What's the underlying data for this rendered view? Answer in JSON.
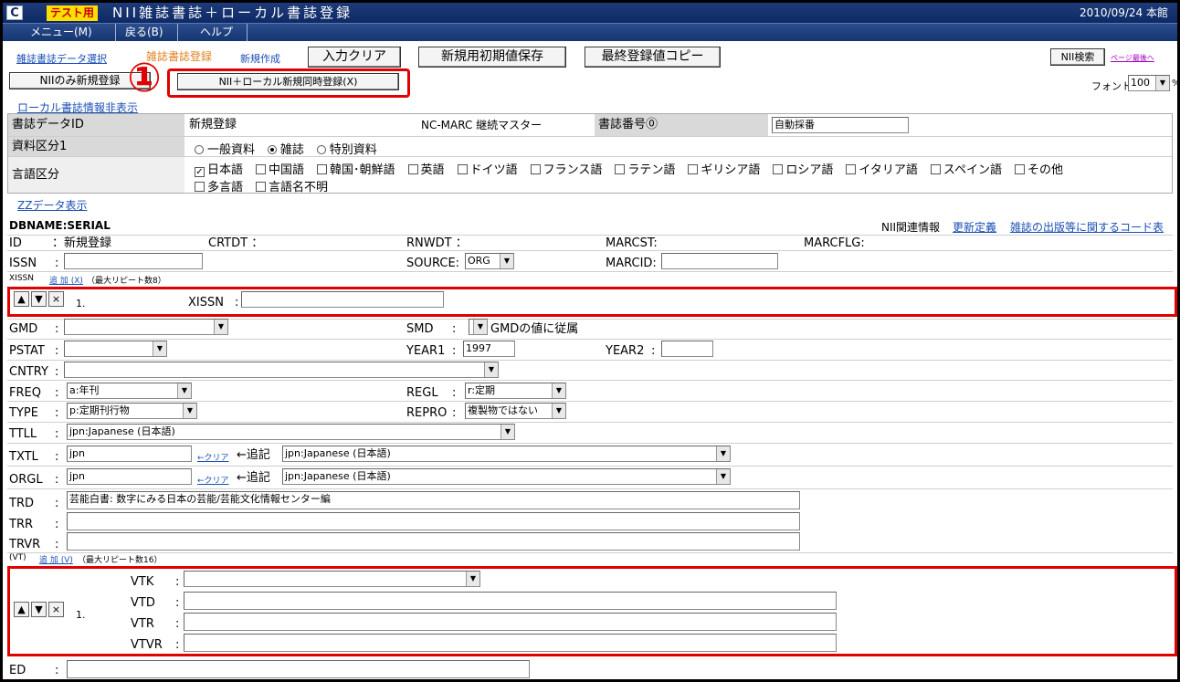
{
  "window": {
    "app_icon": "C",
    "test_badge": "テスト用",
    "title": "NII雑誌書誌＋ローカル書誌登録",
    "date_place": "2010/09/24 本館"
  },
  "menu": [
    "メニュー(M)",
    "戻る(B)",
    "ヘルプ"
  ],
  "toolbar": {
    "link_select": "雑誌書誌データ選択",
    "link_register": "雑誌書誌登録",
    "link_new": "新規作成",
    "btn_clear": "入力クリア",
    "btn_save_initial": "新規用初期値保存",
    "btn_copy_last": "最終登録値コピー",
    "btn_nii_search": "NII検索",
    "link_page_end": "ページ最後へ",
    "btn_nii_only": "NIIのみ新規登録",
    "callout_number": "①",
    "btn_nii_local": "NII＋ローカル新規同時登録(X)",
    "font_label": "フォント",
    "font_value": "100",
    "font_unit": "%"
  },
  "local_info": {
    "section_link": "ローカル書誌情報非表示",
    "row1": {
      "label": "書誌データID",
      "value": "新規登録",
      "marc": "NC-MARC 継続マスター",
      "no_label": "書誌番号⓪",
      "no_value": "自動採番"
    },
    "row2": {
      "label": "資料区分1",
      "options": [
        "一般資料",
        "雑誌",
        "特別資料"
      ],
      "selected": 1
    },
    "row3": {
      "label": "言語区分",
      "options": [
        "日本語",
        "中国語",
        "韓国･朝鮮語",
        "英語",
        "ドイツ語",
        "フランス語",
        "ラテン語",
        "ギリシア語",
        "ロシア語",
        "イタリア語",
        "スペイン語",
        "その他",
        "多言語",
        "言語名不明"
      ],
      "checked": [
        0
      ]
    },
    "zz_link": "ZZデータ表示"
  },
  "db": {
    "name": "DBNAME:SERIAL",
    "nii_related": "NII関連情報",
    "link_update": "更新定義",
    "link_code": "雑誌の出版等に関するコード表"
  },
  "fields": {
    "id_label": "ID",
    "id_value": "：新規登録",
    "crtdt": "CRTDT ：",
    "rnwdt": "RNWDT ：",
    "marcst": "MARCST:",
    "marcflg": "MARCFLG:",
    "issn": "ISSN",
    "source": "SOURCE:",
    "source_value": "ORG",
    "marcid": "MARCID:",
    "xissn_group": "XISSN",
    "xissn_add": "追 加 (X)",
    "xissn_max": "（最大リピート数8）",
    "row_num": "1.",
    "xissn_label": "XISSN",
    "gmd": "GMD",
    "smd": "SMD",
    "smd_note": "GMDの値に従属",
    "pstat": "PSTAT",
    "year1": "YEAR1",
    "year1_value": "1997",
    "year2": "YEAR2",
    "cntry": "CNTRY",
    "freq": "FREQ",
    "freq_value": "a:年刊",
    "regl": "REGL",
    "regl_value": "r:定期",
    "type": "TYPE",
    "type_value": "p:定期刊行物",
    "repro": "REPRO",
    "repro_value": "複製物ではない",
    "ttll": "TTLL",
    "ttll_value": "jpn:Japanese (日本語)",
    "txtl": "TXTL",
    "txtl_value": "jpn",
    "txtl_clear": "←クリア",
    "txtl_append": "←追記",
    "txtl_select": "jpn:Japanese (日本語)",
    "orgl": "ORGL",
    "orgl_value": "jpn",
    "orgl_clear": "←クリア",
    "orgl_append": "←追記",
    "orgl_select": "jpn:Japanese (日本語)",
    "trd": "TRD",
    "trd_value": "芸能白書: 数字にみる日本の芸能/芸能文化情報センター編",
    "trr": "TRR",
    "trvr": "TRVR",
    "vt_group": "(VT)",
    "vt_add": "追 加 (V)",
    "vt_max": "（最大リピート数16）",
    "vtk": "VTK",
    "vtd": "VTD",
    "vtr": "VTR",
    "vtvr": "VTVR",
    "ed": "ED"
  },
  "colors": {
    "title_bar": "#0d2a66",
    "highlight": "#e00000",
    "badge": "#ffde00"
  }
}
